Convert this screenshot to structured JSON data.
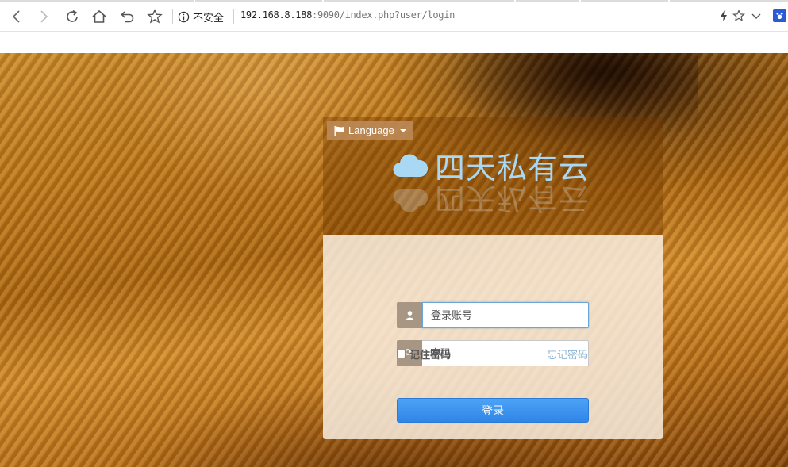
{
  "browser": {
    "security_label": "不安全",
    "url_host": "192.168.8.188",
    "url_rest": ":9090/index.php?user/login",
    "icons": [
      "back-icon",
      "forward-icon",
      "reload-icon",
      "home-icon",
      "undo-icon",
      "bookmark-star-icon",
      "info-icon",
      "lightning-icon",
      "star-icon",
      "chevron-down-icon",
      "paw-icon"
    ]
  },
  "login": {
    "language_label": "Language",
    "brand_name": "四天私有云",
    "username_placeholder": "登录账号",
    "password_placeholder": "密码",
    "remember_label": "记住密码",
    "forgot_label": "忘记密码",
    "submit_label": "登录"
  },
  "colors": {
    "brand_text": "#a9d8f5",
    "button": "#3b8ff0",
    "forgot_link": "#8db4d2",
    "addon": "#a79683"
  }
}
